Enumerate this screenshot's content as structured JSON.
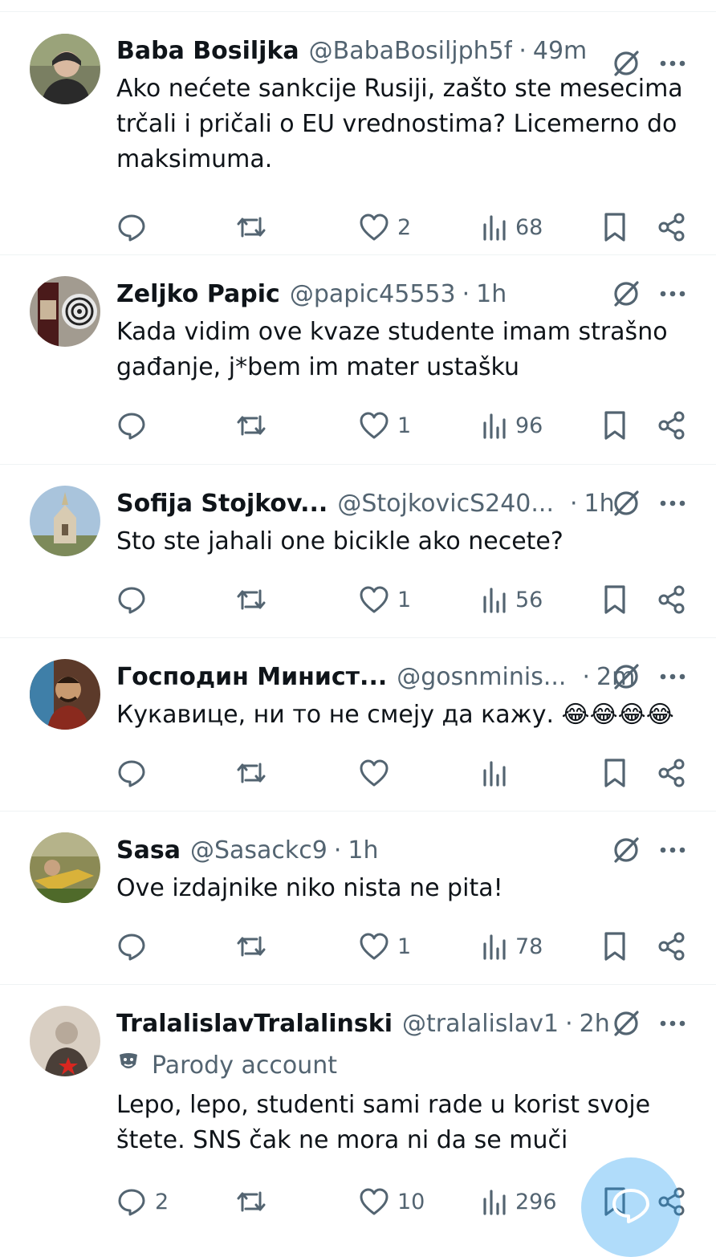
{
  "tweets": [
    {
      "name": "Baba Bosiljka",
      "handle": "@BabaBosiljph5f",
      "time": "49m",
      "text": "Ako nećete sankcije Rusiji, zašto ste mesecima trčali i pričali o EU vrednostima? Licemerno do maksimuma.",
      "replies": "",
      "likes": "2",
      "views": "68"
    },
    {
      "name": "Zeljko Papic",
      "handle": "@papic45553",
      "time": "1h",
      "text": "Kada vidim ove kvaze studente imam strašno gađanje, j*bem im mater ustašku",
      "replies": "",
      "likes": "1",
      "views": "96"
    },
    {
      "name": "Sofija Stojkov...",
      "handle": "@StojkovicS240...",
      "time": "1h",
      "text": "Sto ste jahali one bicikle ako necete?",
      "replies": "",
      "likes": "1",
      "views": "56"
    },
    {
      "name": "Господин Минист...",
      "handle": "@gosnminis...",
      "time": "2m",
      "text": "Кукавице, ни то не смеју да кажу. 😂😂😂😂",
      "replies": "",
      "likes": "",
      "views": ""
    },
    {
      "name": "Sasa",
      "handle": "@Sasackc9",
      "time": "1h",
      "text": "Ove izdajnike niko nista ne pita!",
      "replies": "",
      "likes": "1",
      "views": "78"
    },
    {
      "name": "TralalislavTralalinski",
      "handle": "@tralalislav1",
      "time": "2h",
      "parody_label": "Parody account",
      "text": "Lepo, lepo, studenti sami rade u korist svoje štete. SNS čak ne mora ni da se muči",
      "replies": "2",
      "likes": "10",
      "views": "296"
    }
  ],
  "separator_dot": "·",
  "colors": {
    "text": "#0f1419",
    "secondary": "#536471",
    "divider": "#eff3f4",
    "fab": "#1d9bf0"
  },
  "icons": [
    "grok-icon",
    "more-icon",
    "reply-icon",
    "repost-icon",
    "like-icon",
    "views-icon",
    "bookmark-icon",
    "share-icon",
    "parody-mask-icon",
    "compose-reply-icon"
  ]
}
